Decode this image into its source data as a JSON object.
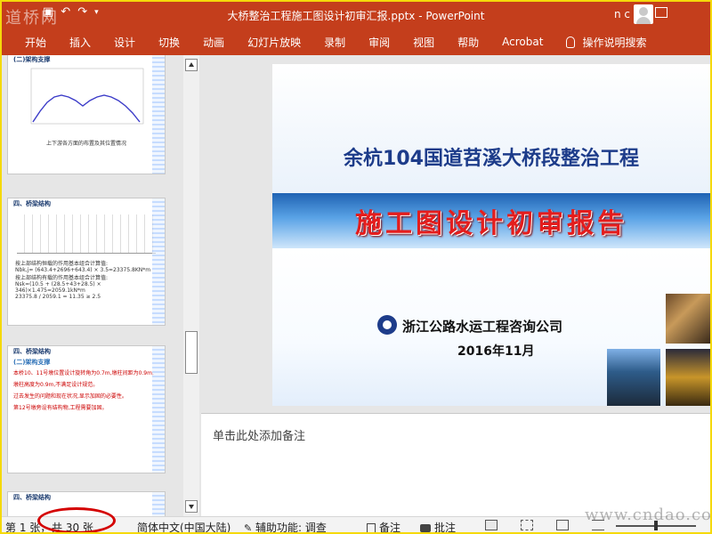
{
  "window": {
    "doc_title": "大桥整治工程施工图设计初审汇报.pptx - PowerPoint",
    "user_initials": "n c",
    "watermark_top": "道桥网",
    "watermark_bottom": "www.cndao.com"
  },
  "qat": {
    "save_icon": "save-icon",
    "undo_icon": "undo-icon",
    "redo_icon": "redo-icon",
    "dropdown_icon": "customize-dropdown-icon"
  },
  "ribbon": {
    "tabs": [
      "开始",
      "插入",
      "设计",
      "切换",
      "动画",
      "幻灯片放映",
      "录制",
      "审阅",
      "视图",
      "帮助",
      "Acrobat"
    ],
    "tell_me": "操作说明搜索"
  },
  "thumbnails": [
    {
      "section": "(二)架构支撑",
      "caption": "上下游各方面的布置及其位置情况"
    },
    {
      "section": "四、桥梁结构",
      "lines": [
        "按上部结构恒载的作用基本组合计算值:",
        "Nbk,j= (643.4+2696+643.4) × 3.5=23375.8KN*m",
        "按上部结构有载的作用基本组合计算值:",
        "Nsk=(10.5 + (28.5+43+28.5) × 346)×1.475=2059.1kN*m",
        "23375.8 / 2059.1 = 11.35 ≥ 2.5"
      ]
    },
    {
      "section": "四、桥梁结构",
      "sub": "(二)架构支撑",
      "bullets": [
        "本桥10、11号墩位置设计旋转角为0.7m,墩柱间距为0.9m,",
        "墩柱高度为0.9m,不满足设计规范。",
        "过去发生的问题和现在状况,显示加固的必要性。",
        "第12号墩旁设有结构物,工程需要加固。"
      ]
    },
    {
      "section": "四、桥梁结构"
    }
  ],
  "slide": {
    "title": "余杭104国道苕溪大桥段整治工程",
    "subtitle": "施工图设计初审报告",
    "company": "浙江公路水运工程咨询公司",
    "date": "2016年11月"
  },
  "notes_placeholder": "单击此处添加备注",
  "status": {
    "slide_of": "第 1 张，",
    "slide_total": "共 30 张",
    "language": "简体中文(中国大陆)",
    "accessibility": "辅助功能: 调查",
    "notes_label": "备注",
    "comments_label": "批注"
  },
  "colors": {
    "accent": "#c43e1c",
    "annotation_circle": "#d40000",
    "slide_title": "#1d3c8a",
    "slide_subtitle": "#e41d1d"
  }
}
